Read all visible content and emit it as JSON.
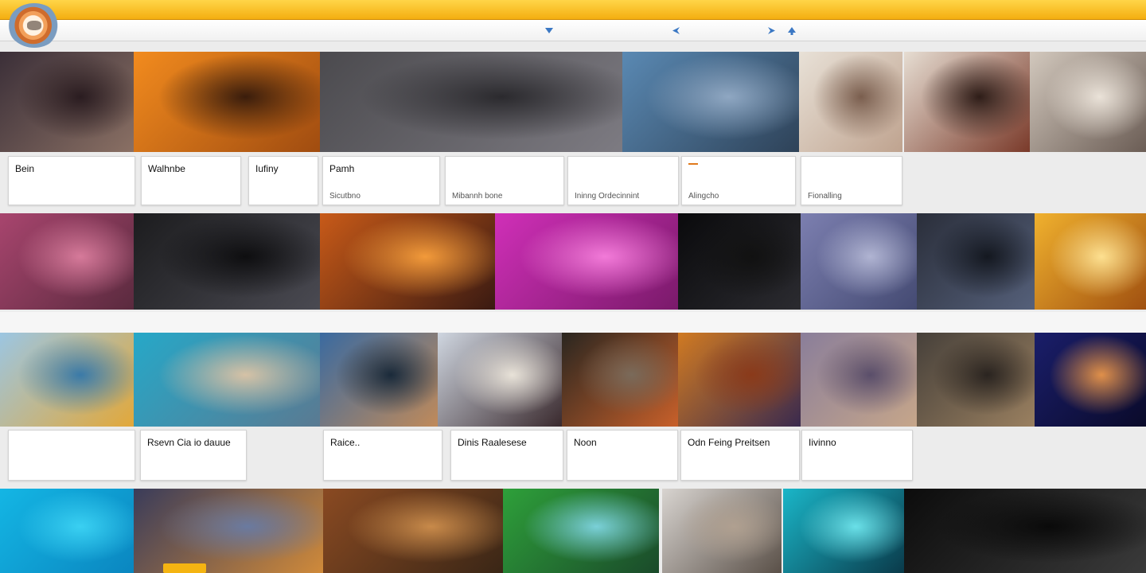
{
  "banner": {
    "text": "",
    "accent": "#f4ae10"
  },
  "nav": {
    "items": [
      "",
      "",
      "",
      ""
    ],
    "right_items": [
      "",
      "",
      ""
    ]
  },
  "feature_row": {
    "headline": "",
    "tiles": [
      {
        "label": "",
        "sub": "",
        "colors": [
          "#3b2f38",
          "#8a7064",
          "#2a1c20"
        ]
      },
      {
        "label": "",
        "sub": "",
        "colors": [
          "#f28b1e",
          "#a04c10",
          "#3a1d0c"
        ]
      },
      {
        "label": "",
        "sub": "",
        "colors": [
          "#4b4a4e",
          "#7d7b82",
          "#2b2a2e"
        ]
      },
      {
        "label": "",
        "sub": "",
        "colors": [
          "#5a89b3",
          "#2e4258",
          "#8fa7c2"
        ]
      },
      {
        "label": "",
        "sub": "",
        "colors": [
          "#e8e1d7",
          "#bfa38f",
          "#7a5e4e"
        ]
      },
      {
        "label": "",
        "sub": "",
        "colors": [
          "#e6ddd2",
          "#7a3a2a",
          "#2e1d18"
        ]
      },
      {
        "label": "",
        "sub": "",
        "colors": [
          "#d2c8bd",
          "#6b5d55",
          "#eae2d8"
        ]
      }
    ]
  },
  "cards_row1": [
    {
      "title": "Bein",
      "line1": "",
      "line2": ""
    },
    {
      "title": "Walhnbe",
      "line1": "",
      "line2": ""
    },
    {
      "title": "Iufiny",
      "line1": "",
      "line2": ""
    },
    {
      "title": "Pamh",
      "line1": "",
      "line2": "Sicutbno"
    },
    {
      "title": "",
      "line1": "",
      "line2": "Mibannh bone"
    },
    {
      "title": "",
      "line1": "",
      "line2": "Ininng Ordecinnint"
    },
    {
      "title": "",
      "line1": "",
      "line2": "Alingcho"
    },
    {
      "title": "",
      "line1": "",
      "line2": "Fionalling"
    }
  ],
  "mid_row": {
    "headline": "",
    "tiles": [
      {
        "label": "",
        "sub": "",
        "colors": [
          "#a8456e",
          "#5a2a3e",
          "#d67a9a"
        ]
      },
      {
        "label": "",
        "sub": "",
        "colors": [
          "#1c1c1e",
          "#4a4a52",
          "#0e0e10"
        ]
      },
      {
        "label": "",
        "sub": "",
        "colors": [
          "#c85a18",
          "#3a1a12",
          "#f29a3a"
        ]
      },
      {
        "label": "",
        "sub": "",
        "colors": [
          "#d02fb8",
          "#7a1a6a",
          "#f27ad8"
        ]
      },
      {
        "label": "",
        "sub": "",
        "colors": [
          "#0a0a0c",
          "#2b2b30",
          "#111"
        ]
      },
      {
        "label": "",
        "sub": "",
        "colors": [
          "#7c7fb0",
          "#444a72",
          "#b0b4d2"
        ]
      },
      {
        "label": "",
        "sub": "",
        "colors": [
          "#2a2e3a",
          "#55607a",
          "#141820"
        ]
      },
      {
        "label": "",
        "sub": "",
        "colors": [
          "#f0b12e",
          "#a05010",
          "#fde090"
        ]
      }
    ]
  },
  "strip_links": [
    "",
    "",
    "",
    "",
    ""
  ],
  "row3": {
    "tiles": [
      {
        "label": "",
        "sub": "",
        "colors": [
          "#9cc6e2",
          "#e2a83a",
          "#3a7aa8"
        ]
      },
      {
        "label": "",
        "sub": "",
        "colors": [
          "#26a8c8",
          "#5a7a92",
          "#d6c2a6"
        ]
      },
      {
        "label": "",
        "sub": "",
        "colors": [
          "#3a6aa0",
          "#c08a5a",
          "#1a2a3a"
        ]
      },
      {
        "label": "",
        "sub": "",
        "colors": [
          "#cfd6e0",
          "#3a2a2e",
          "#e8e2d8"
        ]
      },
      {
        "label": "",
        "sub": "",
        "colors": [
          "#2a2620",
          "#c8602a",
          "#7a6a5a"
        ]
      },
      {
        "label": "",
        "sub": "",
        "colors": [
          "#d07a22",
          "#3a2a4e",
          "#8a3a1a"
        ]
      },
      {
        "label": "",
        "sub": "",
        "colors": [
          "#8a7e9a",
          "#c6a68a",
          "#5a4e6a"
        ]
      },
      {
        "label": "",
        "sub": "",
        "colors": [
          "#46403a",
          "#9a8060",
          "#2a2420"
        ]
      },
      {
        "label": "",
        "sub": "",
        "colors": [
          "#1a1e6a",
          "#0a0a2a",
          "#e0904a"
        ]
      }
    ]
  },
  "cards_row2": [
    {
      "title": "",
      "line1": "",
      "line2": ""
    },
    {
      "title": "Rsevn Cia io dauue",
      "line1": "",
      "line2": ""
    },
    {
      "title": "Raice..",
      "line1": "",
      "line2": ""
    },
    {
      "title": "Dinis  Raalesese",
      "line1": "",
      "line2": ""
    },
    {
      "title": "Noon",
      "line1": "",
      "line2": ""
    },
    {
      "title": "Odn  Feing Preitsen",
      "line1": "",
      "line2": ""
    },
    {
      "title": "Iivinno",
      "line1": "",
      "line2": ""
    }
  ],
  "bottom_row": {
    "tiles": [
      {
        "label": "",
        "colors": [
          "#14b6e4",
          "#0a86c0",
          "#3ad0f2"
        ]
      },
      {
        "label": "",
        "colors": [
          "#3a3c5a",
          "#d08a3a",
          "#6a7aa0"
        ]
      },
      {
        "label": "",
        "colors": [
          "#8a4a22",
          "#3a2616",
          "#c88a4a"
        ]
      },
      {
        "label": "",
        "colors": [
          "#2ea03a",
          "#1a4a2a",
          "#7ad0d8"
        ]
      },
      {
        "label": "",
        "colors": [
          "#d8d4d0",
          "#5a5048",
          "#b0a090"
        ]
      },
      {
        "label": "",
        "colors": [
          "#1ab6c8",
          "#0a3a4a",
          "#6ae0e8"
        ]
      },
      {
        "label": "",
        "colors": [
          "#0c0c0c",
          "#3a3a3a",
          "#0a0a0a"
        ]
      }
    ],
    "play_label": ""
  }
}
